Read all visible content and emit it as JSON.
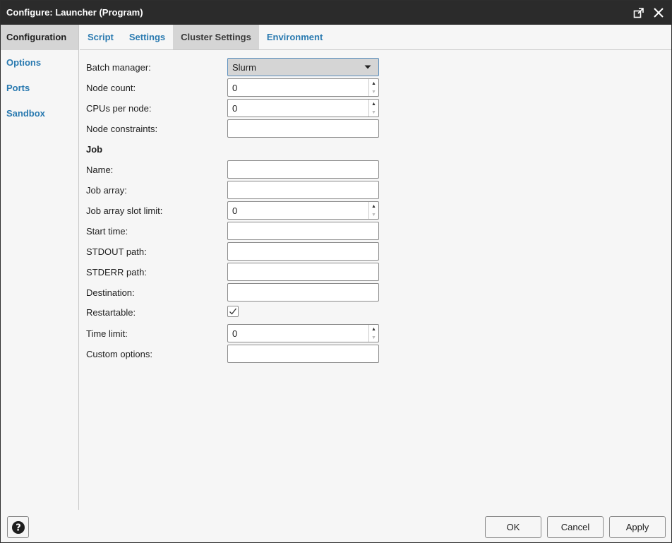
{
  "window": {
    "title": "Configure: Launcher (Program)",
    "maximize_icon": "external-window-icon",
    "close_icon": "close-icon"
  },
  "sidebar": {
    "items": [
      {
        "label": "Configuration",
        "active": true
      },
      {
        "label": "Options",
        "active": false
      },
      {
        "label": "Ports",
        "active": false
      },
      {
        "label": "Sandbox",
        "active": false
      }
    ]
  },
  "tabs": [
    {
      "label": "Script",
      "active": false
    },
    {
      "label": "Settings",
      "active": false
    },
    {
      "label": "Cluster Settings",
      "active": true
    },
    {
      "label": "Environment",
      "active": false
    }
  ],
  "form": {
    "batch_manager": {
      "label": "Batch manager:",
      "value": "Slurm"
    },
    "node_count": {
      "label": "Node count:",
      "value": "0"
    },
    "cpus_per_node": {
      "label": "CPUs per node:",
      "value": "0"
    },
    "node_constraints": {
      "label": "Node constraints:",
      "value": ""
    },
    "job_section": "Job",
    "name": {
      "label": "Name:",
      "value": ""
    },
    "job_array": {
      "label": "Job array:",
      "value": ""
    },
    "job_array_slot_limit": {
      "label": "Job array slot limit:",
      "value": "0"
    },
    "start_time": {
      "label": "Start time:",
      "value": ""
    },
    "stdout_path": {
      "label": "STDOUT path:",
      "value": ""
    },
    "stderr_path": {
      "label": "STDERR path:",
      "value": ""
    },
    "destination": {
      "label": "Destination:",
      "value": ""
    },
    "restartable": {
      "label": "Restartable:",
      "checked": true
    },
    "time_limit": {
      "label": "Time limit:",
      "value": "0"
    },
    "custom_options": {
      "label": "Custom options:",
      "value": ""
    }
  },
  "footer": {
    "help_icon": "help-icon",
    "ok_label": "OK",
    "cancel_label": "Cancel",
    "apply_label": "Apply"
  },
  "colors": {
    "titlebar": "#2b2b2b",
    "link": "#2a7ab0",
    "active_bg": "#d5d5d5",
    "background": "#f6f6f6"
  }
}
